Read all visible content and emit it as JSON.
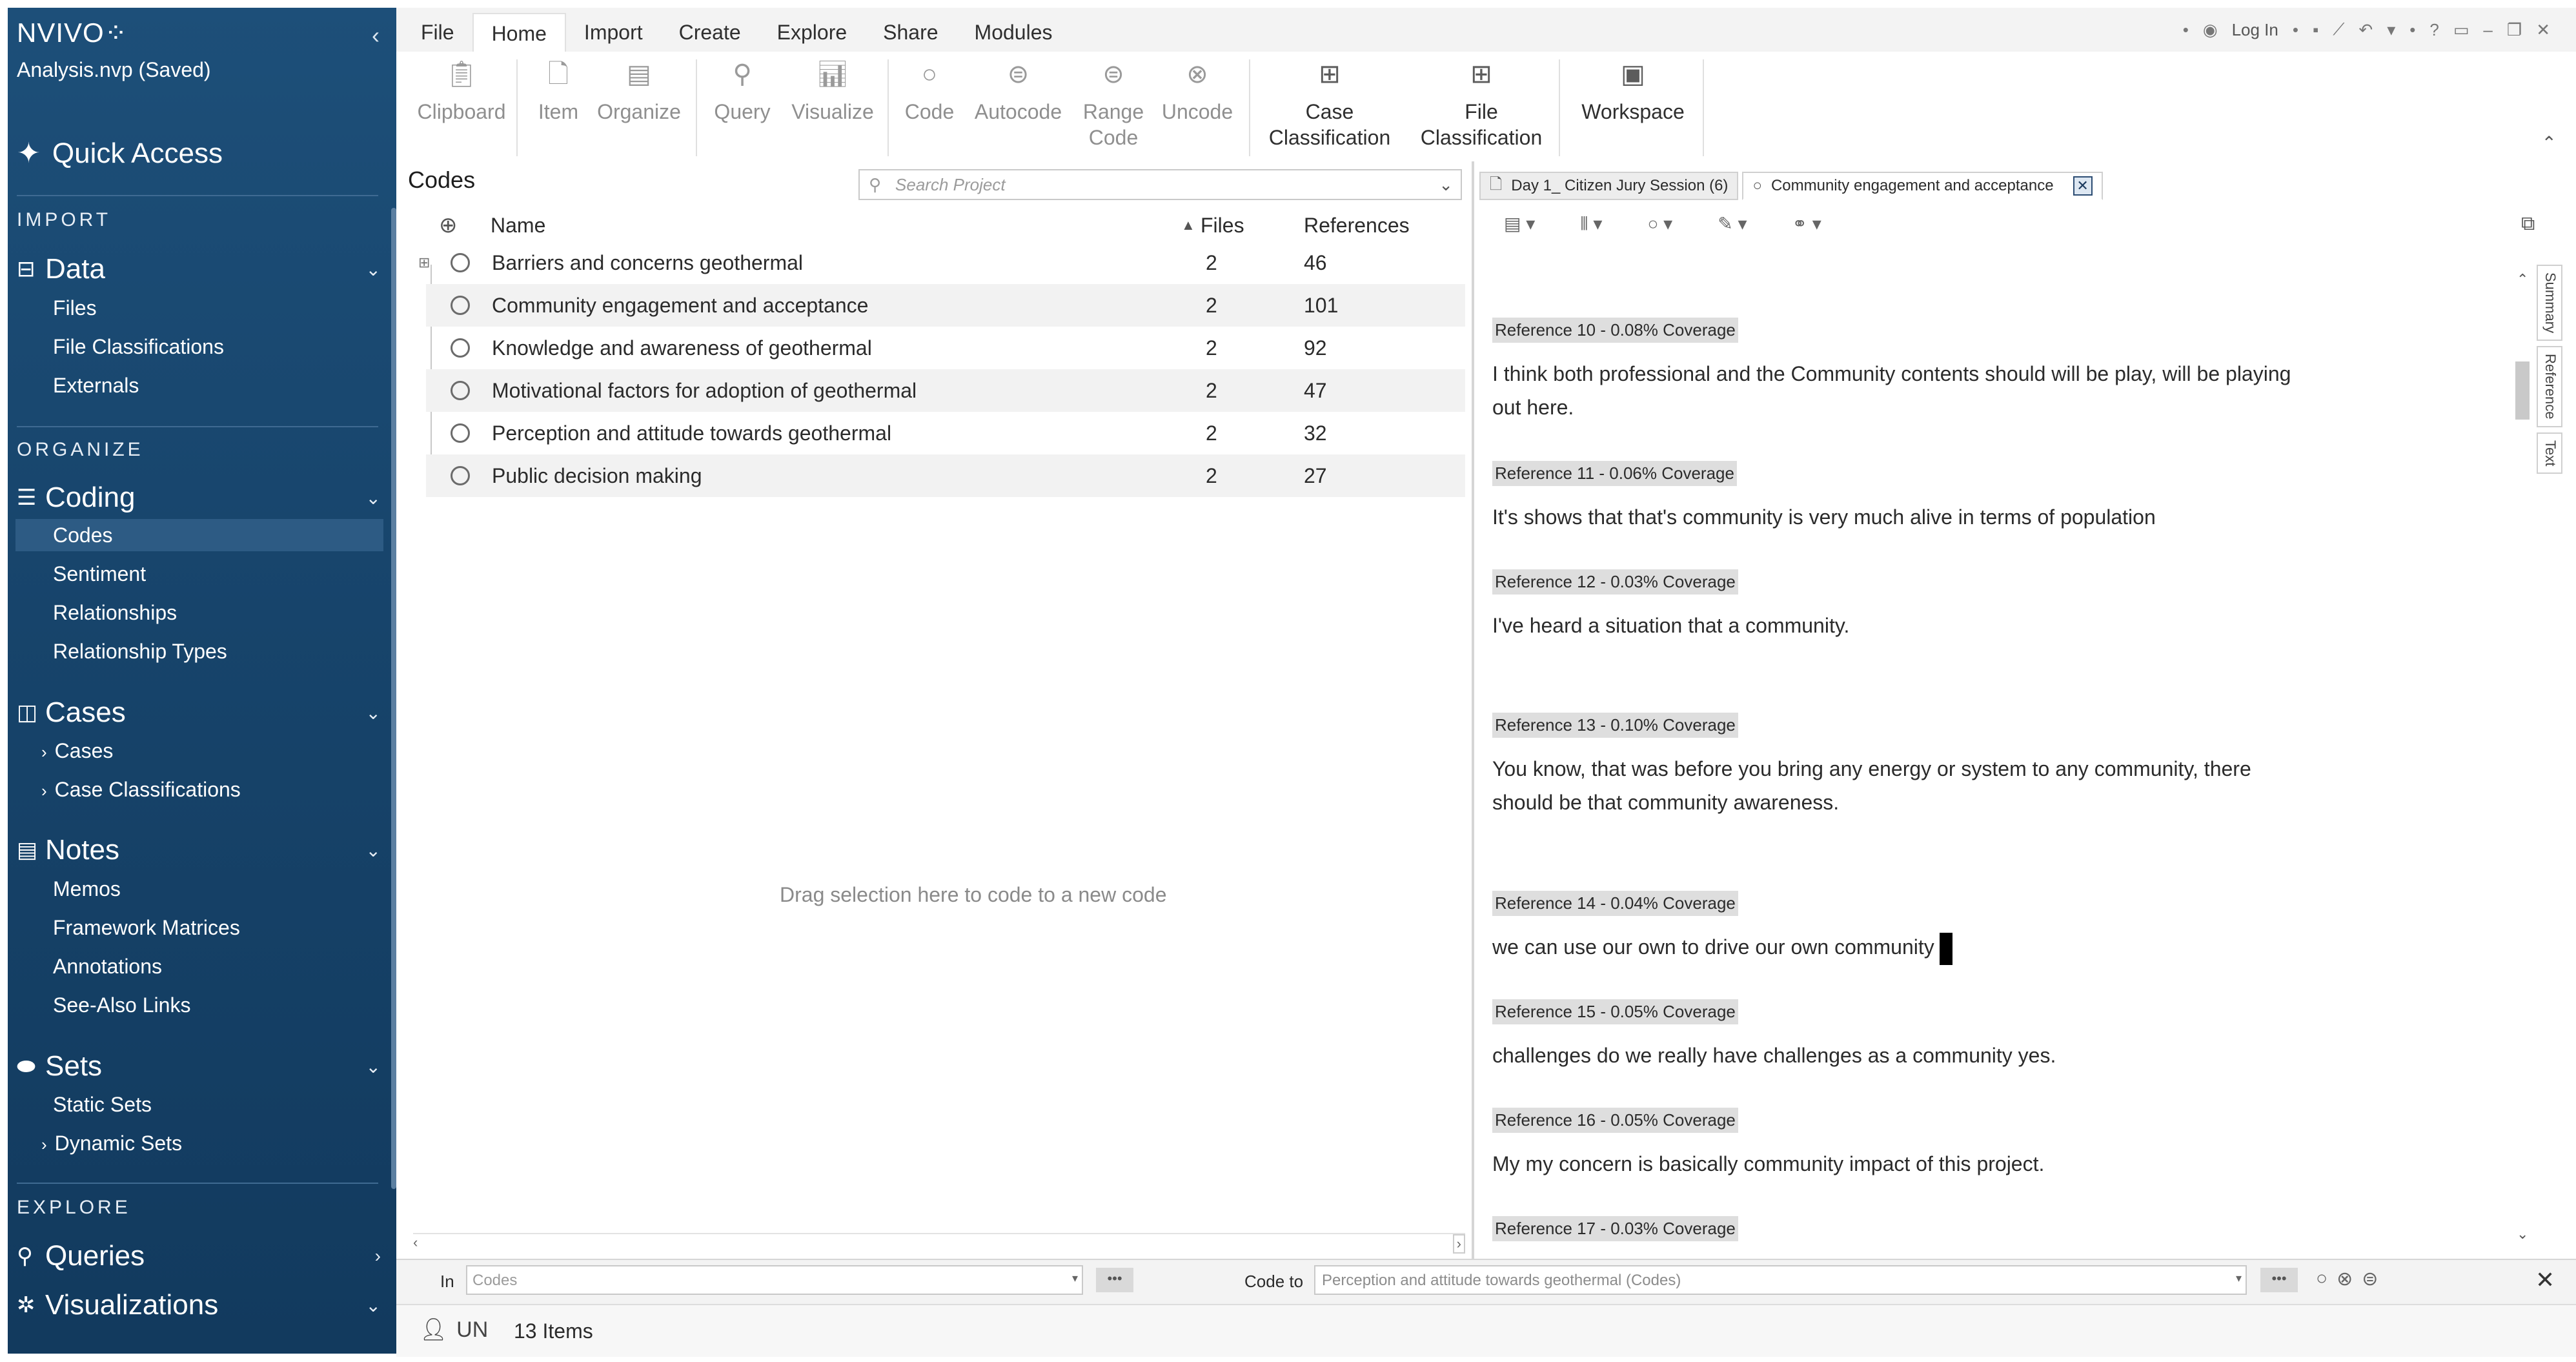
{
  "app": {
    "brand": "NVIVO",
    "project": "Analysis.nvp (Saved)",
    "quick_access": "Quick Access"
  },
  "sidebar": {
    "import_heading": "IMPORT",
    "data": {
      "label": "Data",
      "items": [
        "Files",
        "File Classifications",
        "Externals"
      ]
    },
    "organize_heading": "ORGANIZE",
    "coding": {
      "label": "Coding",
      "items": [
        "Codes",
        "Sentiment",
        "Relationships",
        "Relationship Types"
      ],
      "selected": "Codes"
    },
    "cases": {
      "label": "Cases",
      "items": [
        "Cases",
        "Case Classifications"
      ]
    },
    "notes": {
      "label": "Notes",
      "items": [
        "Memos",
        "Framework Matrices",
        "Annotations",
        "See-Also Links"
      ]
    },
    "sets": {
      "label": "Sets",
      "items": [
        "Static Sets",
        "Dynamic Sets"
      ]
    },
    "explore_heading": "EXPLORE",
    "queries": {
      "label": "Queries"
    },
    "visualizations": {
      "label": "Visualizations"
    }
  },
  "menu": [
    "File",
    "Home",
    "Import",
    "Create",
    "Explore",
    "Share",
    "Modules"
  ],
  "menu_active": "Home",
  "topbar": {
    "login": "Log In"
  },
  "ribbon": {
    "clipboard": "Clipboard",
    "item": "Item",
    "organize": "Organize",
    "query": "Query",
    "visualize": "Visualize",
    "code": "Code",
    "autocode": "Autocode",
    "range_code_1": "Range",
    "range_code_2": "Code",
    "uncode": "Uncode",
    "case_class_1": "Case",
    "case_class_2": "Classification",
    "file_class_1": "File",
    "file_class_2": "Classification",
    "workspace": "Workspace"
  },
  "codes": {
    "title": "Codes",
    "search_placeholder": "Search Project",
    "columns": {
      "name": "Name",
      "files": "Files",
      "references": "References"
    },
    "rows": [
      {
        "name": "Barriers and concerns geothermal",
        "files": "2",
        "references": "46"
      },
      {
        "name": "Community engagement and acceptance",
        "files": "2",
        "references": "101"
      },
      {
        "name": "Knowledge and awareness of geothermal",
        "files": "2",
        "references": "92"
      },
      {
        "name": "Motivational factors for adoption of geothermal",
        "files": "2",
        "references": "47"
      },
      {
        "name": "Perception and attitude towards geothermal",
        "files": "2",
        "references": "32"
      },
      {
        "name": "Public decision making",
        "files": "2",
        "references": "27"
      }
    ],
    "drag_hint": "Drag selection here to code to a new code"
  },
  "detail": {
    "tabs": [
      {
        "label": "Day 1_ Citizen Jury Session (6)"
      },
      {
        "label": "Community engagement and acceptance"
      }
    ],
    "side_tabs": [
      "Summary",
      "Reference",
      "Text"
    ],
    "references": [
      {
        "header": "Reference 10 - 0.08% Coverage",
        "text": "I think both professional and the Community contents should will be play, will be playing out here."
      },
      {
        "header": "Reference 11 - 0.06% Coverage",
        "text": "It's shows that that's community is very much alive in terms of population"
      },
      {
        "header": "Reference 12 - 0.03% Coverage",
        "text": "I've heard a situation that a community."
      },
      {
        "header": "Reference 13 - 0.10% Coverage",
        "text": "You know, that was before you bring any energy or system to any community, there should be that community awareness."
      },
      {
        "header": "Reference 14 - 0.04% Coverage",
        "text": "we can use our own to drive our own community"
      },
      {
        "header": "Reference 15 - 0.05% Coverage",
        "text": "challenges do we really have challenges as a community yes."
      },
      {
        "header": "Reference 16 - 0.05% Coverage",
        "text": "My my concern is basically community impact of this project."
      },
      {
        "header": "Reference 17 - 0.03% Coverage",
        "text": ""
      }
    ]
  },
  "bottom": {
    "in_label": "In",
    "in_value": "Codes",
    "code_to_label": "Code to",
    "code_to_value": "Perception and attitude towards geothermal (Codes)",
    "dots": "•••"
  },
  "status": {
    "user": "UN",
    "items": "13 Items"
  }
}
